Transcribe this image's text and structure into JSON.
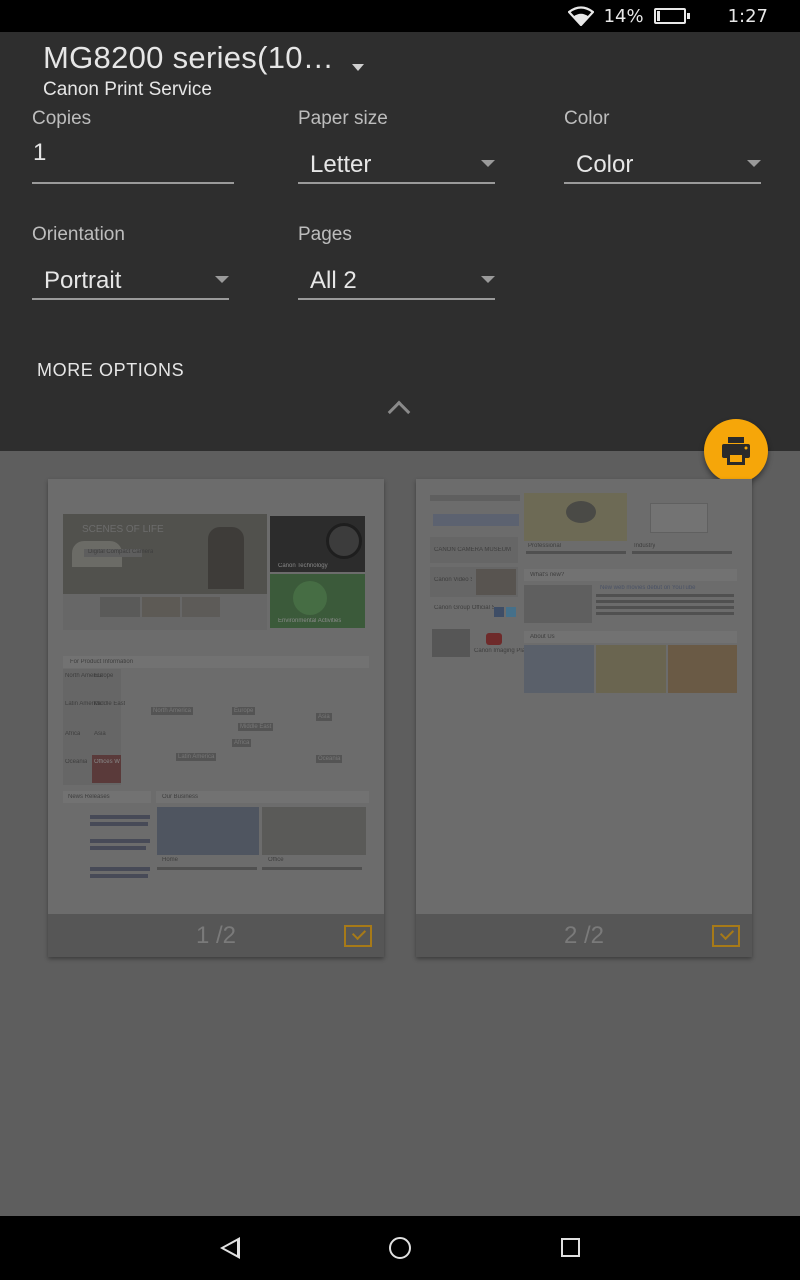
{
  "status_bar": {
    "battery_percent_label": "14%",
    "battery_level": 0.14,
    "time": "1:27",
    "icons": [
      "wifi-icon",
      "battery-icon"
    ]
  },
  "print_panel": {
    "printer_name": "MG8200 series(10…",
    "service": "Canon Print Service",
    "copies": {
      "label": "Copies",
      "value": "1"
    },
    "paper_size": {
      "label": "Paper size",
      "value": "Letter"
    },
    "color": {
      "label": "Color",
      "value": "Color"
    },
    "orientation": {
      "label": "Orientation",
      "value": "Portrait"
    },
    "pages": {
      "label": "Pages",
      "value": "All 2"
    },
    "more_options": "MORE OPTIONS",
    "accent_color": "#f6a609"
  },
  "previews": [
    {
      "page_label": "1 /2",
      "selected": true,
      "texts": {
        "hero": "SCENES OF LIFE",
        "hero_button": "Digital Compact Camera",
        "side_1": "Canon Technology",
        "side_2": "Environmental Activities",
        "product_info": "For Product Information",
        "regions": [
          "North America",
          "Europe",
          "Latin America",
          "Middle East",
          "Africa",
          "Asia",
          "Oceania",
          "Offices Worldwide"
        ],
        "map_tags": [
          "North America",
          "Europe",
          "Asia",
          "Middle East",
          "Oceania",
          "Latin America",
          "Africa"
        ],
        "news": "News Releases",
        "business": "Our Business",
        "home": "Home",
        "office": "Office"
      }
    },
    {
      "page_label": "2 /2",
      "selected": true,
      "texts": {
        "camera_museum": "CANON CAMERA MUSEUM",
        "video_square": "Canon Video Square",
        "social": "Canon Group Official Social Media Account Lists",
        "imaging_plaza": "Canon Imaging Plaza",
        "professional": "Professional",
        "industry": "Industry",
        "whats_new": "What's new?",
        "new_movies": "New web movies debut on YouTube",
        "about_us": "About Us"
      }
    }
  ],
  "nav_bar": {
    "icons": [
      "back-icon",
      "home-icon",
      "recents-icon"
    ]
  }
}
